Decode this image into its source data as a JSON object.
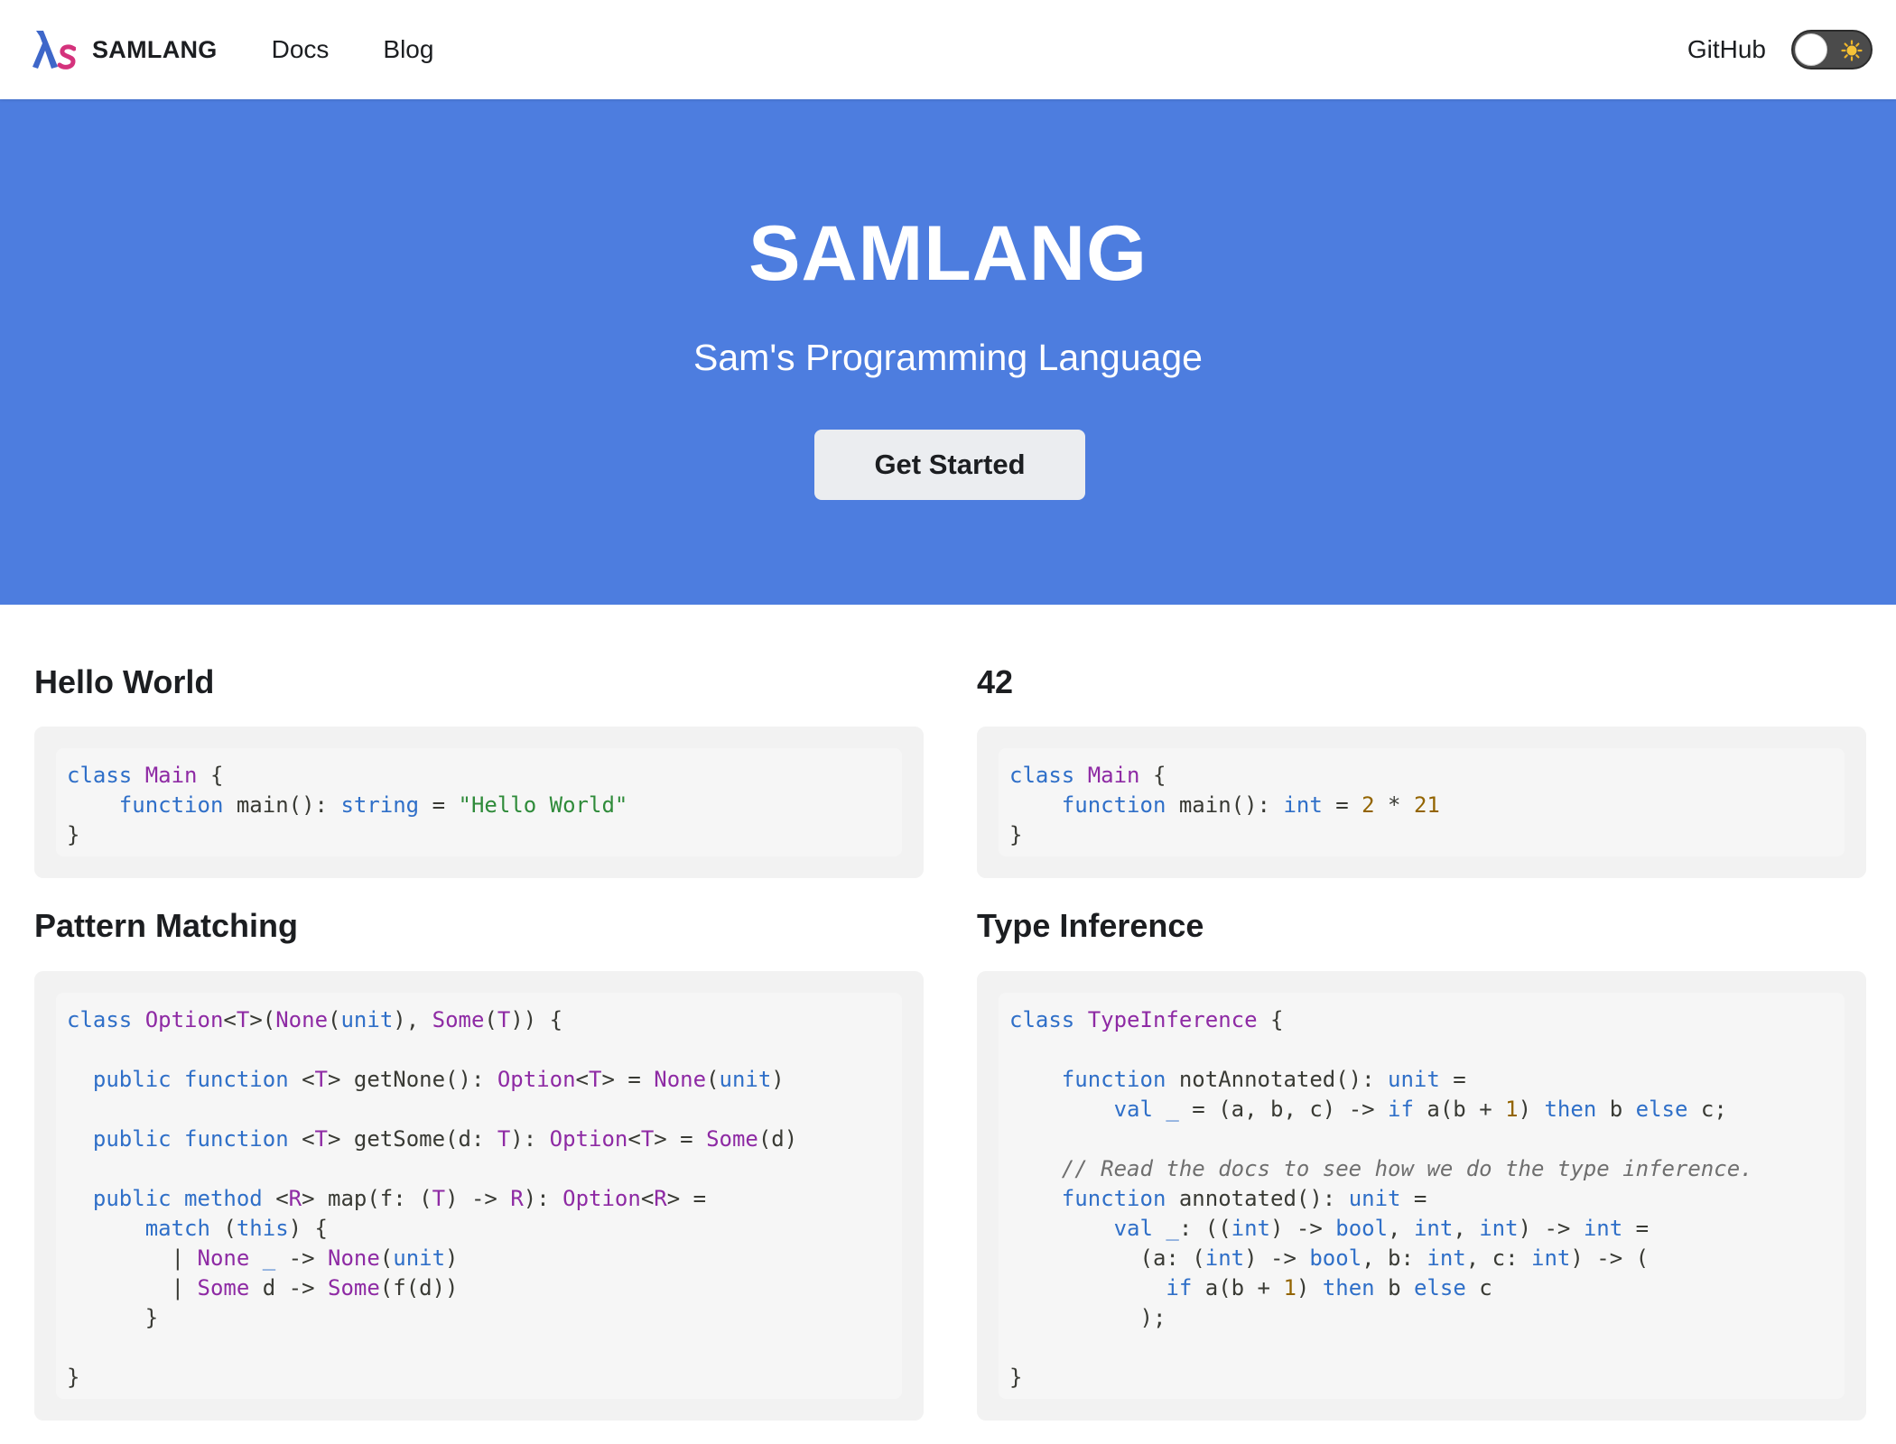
{
  "navbar": {
    "brand": "SAMLANG",
    "links": [
      "Docs",
      "Blog"
    ],
    "github": "GitHub",
    "logo_icon": "lambda-s-logo-icon",
    "theme_toggle_icon": "sun-icon"
  },
  "hero": {
    "title": "SAMLANG",
    "subtitle": "Sam's Programming Language",
    "button": "Get Started",
    "background": "#4d7ddf"
  },
  "examples": [
    {
      "title": "Hello World",
      "code": [
        [
          [
            "kw",
            "class "
          ],
          [
            "ty",
            "Main"
          ],
          [
            "pl",
            " {"
          ]
        ],
        [
          [
            "pl",
            "    "
          ],
          [
            "kw",
            "function "
          ],
          [
            "pl",
            "main(): "
          ],
          [
            "kw",
            "string"
          ],
          [
            "pl",
            " = "
          ],
          [
            "st",
            "\"Hello World\""
          ]
        ],
        [
          [
            "pl",
            "}"
          ]
        ]
      ]
    },
    {
      "title": "42",
      "code": [
        [
          [
            "kw",
            "class "
          ],
          [
            "ty",
            "Main"
          ],
          [
            "pl",
            " {"
          ]
        ],
        [
          [
            "pl",
            "    "
          ],
          [
            "kw",
            "function "
          ],
          [
            "pl",
            "main(): "
          ],
          [
            "kw",
            "int"
          ],
          [
            "pl",
            " = "
          ],
          [
            "nm",
            "2"
          ],
          [
            "pl",
            " * "
          ],
          [
            "nm",
            "21"
          ]
        ],
        [
          [
            "pl",
            "}"
          ]
        ]
      ]
    },
    {
      "title": "Pattern Matching",
      "code": [
        [
          [
            "kw",
            "class "
          ],
          [
            "ty",
            "Option"
          ],
          [
            "pl",
            "<"
          ],
          [
            "ty",
            "T"
          ],
          [
            "pl",
            ">("
          ],
          [
            "ty",
            "None"
          ],
          [
            "pl",
            "("
          ],
          [
            "kw",
            "unit"
          ],
          [
            "pl",
            "), "
          ],
          [
            "ty",
            "Some"
          ],
          [
            "pl",
            "("
          ],
          [
            "ty",
            "T"
          ],
          [
            "pl",
            ")) {"
          ]
        ],
        [],
        [
          [
            "pl",
            "  "
          ],
          [
            "kw",
            "public function "
          ],
          [
            "pl",
            "<"
          ],
          [
            "ty",
            "T"
          ],
          [
            "pl",
            "> getNone(): "
          ],
          [
            "ty",
            "Option"
          ],
          [
            "pl",
            "<"
          ],
          [
            "ty",
            "T"
          ],
          [
            "pl",
            "> = "
          ],
          [
            "ty",
            "None"
          ],
          [
            "pl",
            "("
          ],
          [
            "kw",
            "unit"
          ],
          [
            "pl",
            ")"
          ]
        ],
        [],
        [
          [
            "pl",
            "  "
          ],
          [
            "kw",
            "public function "
          ],
          [
            "pl",
            "<"
          ],
          [
            "ty",
            "T"
          ],
          [
            "pl",
            "> getSome(d: "
          ],
          [
            "ty",
            "T"
          ],
          [
            "pl",
            "): "
          ],
          [
            "ty",
            "Option"
          ],
          [
            "pl",
            "<"
          ],
          [
            "ty",
            "T"
          ],
          [
            "pl",
            "> = "
          ],
          [
            "ty",
            "Some"
          ],
          [
            "pl",
            "(d)"
          ]
        ],
        [],
        [
          [
            "pl",
            "  "
          ],
          [
            "kw",
            "public method "
          ],
          [
            "pl",
            "<"
          ],
          [
            "ty",
            "R"
          ],
          [
            "pl",
            "> map(f: ("
          ],
          [
            "ty",
            "T"
          ],
          [
            "pl",
            ") -> "
          ],
          [
            "ty",
            "R"
          ],
          [
            "pl",
            "): "
          ],
          [
            "ty",
            "Option"
          ],
          [
            "pl",
            "<"
          ],
          [
            "ty",
            "R"
          ],
          [
            "pl",
            "> ="
          ]
        ],
        [
          [
            "pl",
            "      "
          ],
          [
            "kw",
            "match "
          ],
          [
            "pl",
            "("
          ],
          [
            "kw",
            "this"
          ],
          [
            "pl",
            ") {"
          ]
        ],
        [
          [
            "pl",
            "        | "
          ],
          [
            "ty",
            "None "
          ],
          [
            "kw",
            "_"
          ],
          [
            "pl",
            " -> "
          ],
          [
            "ty",
            "None"
          ],
          [
            "pl",
            "("
          ],
          [
            "kw",
            "unit"
          ],
          [
            "pl",
            ")"
          ]
        ],
        [
          [
            "pl",
            "        | "
          ],
          [
            "ty",
            "Some "
          ],
          [
            "pl",
            "d -> "
          ],
          [
            "ty",
            "Some"
          ],
          [
            "pl",
            "(f(d))"
          ]
        ],
        [
          [
            "pl",
            "      }"
          ]
        ],
        [],
        [
          [
            "pl",
            "}"
          ]
        ]
      ]
    },
    {
      "title": "Type Inference",
      "code": [
        [
          [
            "kw",
            "class "
          ],
          [
            "ty",
            "TypeInference"
          ],
          [
            "pl",
            " {"
          ]
        ],
        [],
        [
          [
            "pl",
            "    "
          ],
          [
            "kw",
            "function "
          ],
          [
            "pl",
            "notAnnotated(): "
          ],
          [
            "kw",
            "unit"
          ],
          [
            "pl",
            " ="
          ]
        ],
        [
          [
            "pl",
            "        "
          ],
          [
            "kw",
            "val _ "
          ],
          [
            "pl",
            "= (a, b, c) -> "
          ],
          [
            "kw",
            "if "
          ],
          [
            "pl",
            "a(b + "
          ],
          [
            "nm",
            "1"
          ],
          [
            "pl",
            ") "
          ],
          [
            "kw",
            "then "
          ],
          [
            "pl",
            "b "
          ],
          [
            "kw",
            "else "
          ],
          [
            "pl",
            "c;"
          ]
        ],
        [],
        [
          [
            "pl",
            "    "
          ],
          [
            "cm",
            "// Read the docs to see how we do the type inference."
          ]
        ],
        [
          [
            "pl",
            "    "
          ],
          [
            "kw",
            "function "
          ],
          [
            "pl",
            "annotated(): "
          ],
          [
            "kw",
            "unit"
          ],
          [
            "pl",
            " ="
          ]
        ],
        [
          [
            "pl",
            "        "
          ],
          [
            "kw",
            "val _"
          ],
          [
            "pl",
            ": (("
          ],
          [
            "kw",
            "int"
          ],
          [
            "pl",
            ") -> "
          ],
          [
            "kw",
            "bool"
          ],
          [
            "pl",
            ", "
          ],
          [
            "kw",
            "int"
          ],
          [
            "pl",
            ", "
          ],
          [
            "kw",
            "int"
          ],
          [
            "pl",
            ") -> "
          ],
          [
            "kw",
            "int"
          ],
          [
            "pl",
            " ="
          ]
        ],
        [
          [
            "pl",
            "          (a: ("
          ],
          [
            "kw",
            "int"
          ],
          [
            "pl",
            ") -> "
          ],
          [
            "kw",
            "bool"
          ],
          [
            "pl",
            ", b: "
          ],
          [
            "kw",
            "int"
          ],
          [
            "pl",
            ", c: "
          ],
          [
            "kw",
            "int"
          ],
          [
            "pl",
            ") -> ("
          ]
        ],
        [
          [
            "pl",
            "            "
          ],
          [
            "kw",
            "if "
          ],
          [
            "pl",
            "a(b + "
          ],
          [
            "nm",
            "1"
          ],
          [
            "pl",
            ") "
          ],
          [
            "kw",
            "then "
          ],
          [
            "pl",
            "b "
          ],
          [
            "kw",
            "else "
          ],
          [
            "pl",
            "c"
          ]
        ],
        [
          [
            "pl",
            "          );"
          ]
        ],
        [],
        [
          [
            "pl",
            "}"
          ]
        ]
      ]
    }
  ]
}
